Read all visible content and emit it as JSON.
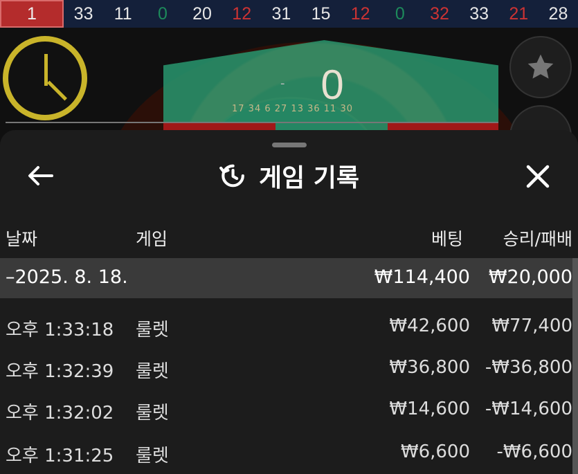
{
  "results_strip": [
    {
      "value": "1",
      "color": "red",
      "highlight": true
    },
    {
      "value": "33",
      "color": "black"
    },
    {
      "value": "11",
      "color": "black"
    },
    {
      "value": "0",
      "color": "green"
    },
    {
      "value": "20",
      "color": "black"
    },
    {
      "value": "12",
      "color": "red"
    },
    {
      "value": "31",
      "color": "black"
    },
    {
      "value": "15",
      "color": "black"
    },
    {
      "value": "12",
      "color": "red"
    },
    {
      "value": "0",
      "color": "green"
    },
    {
      "value": "32",
      "color": "red"
    },
    {
      "value": "33",
      "color": "black"
    },
    {
      "value": "21",
      "color": "red"
    },
    {
      "value": "28",
      "color": "black"
    }
  ],
  "game": {
    "bet_number": "0",
    "bet_dash": "-",
    "wheel_numbers": "17 34 6 27 13 36 11 30"
  },
  "icons": {
    "timer": "clock-icon",
    "favorite": "star-icon",
    "stats": "stats-icon",
    "back": "arrow-left-icon",
    "history": "history-icon",
    "close": "close-icon"
  },
  "sheet": {
    "title": "게임 기록",
    "columns": {
      "date": "날짜",
      "game": "게임",
      "bet": "베팅",
      "result": "승리/패배"
    },
    "date_group": {
      "label": "–2025. 8. 18.",
      "bet_total": "₩114,400",
      "result_total": "₩20,000"
    },
    "rows": [
      {
        "time": "오후 1:33:18",
        "game": "룰렛",
        "bet": "₩42,600",
        "result": "₩77,400"
      },
      {
        "time": "오후 1:32:39",
        "game": "룰렛",
        "bet": "₩36,800",
        "result": "-₩36,800"
      },
      {
        "time": "오후 1:32:02",
        "game": "룰렛",
        "bet": "₩14,600",
        "result": "-₩14,600"
      },
      {
        "time": "오후 1:31:25",
        "game": "룰렛",
        "bet": "₩6,600",
        "result": "-₩6,600"
      }
    ]
  },
  "colors": {
    "red": "#c33",
    "green": "#1d8a5b",
    "sheet_bg": "#1c1c1c",
    "date_row_bg": "#3a3a3a"
  }
}
